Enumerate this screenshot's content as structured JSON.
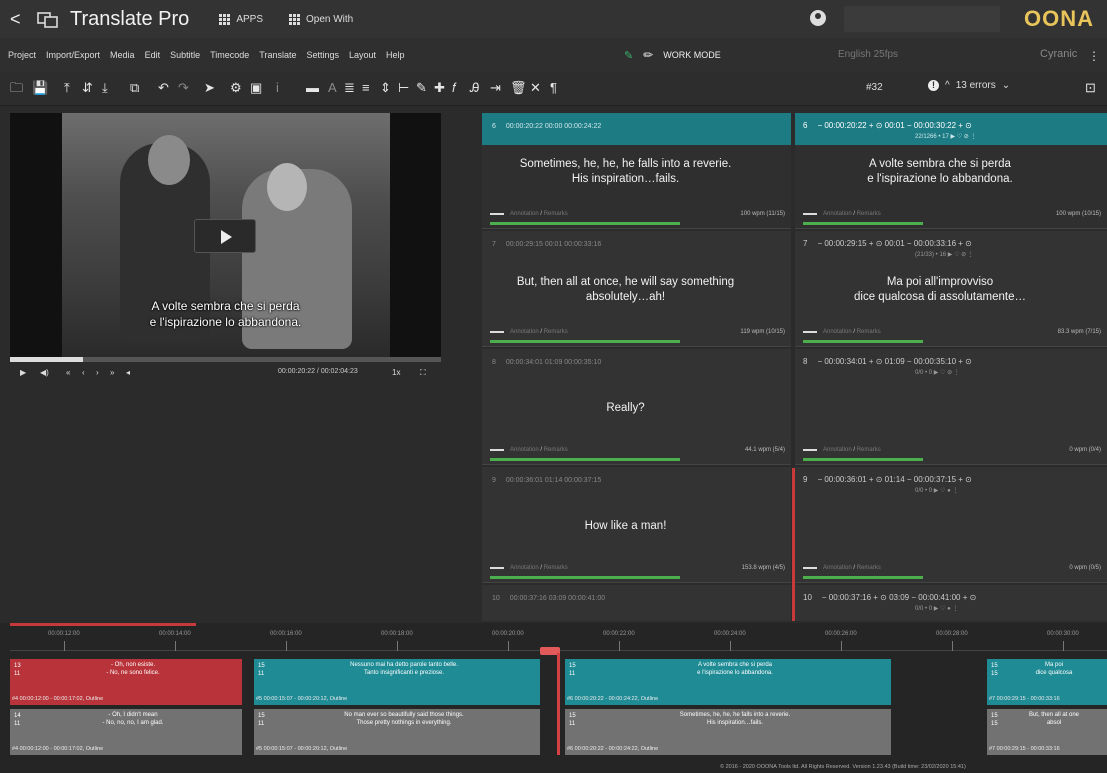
{
  "app": {
    "title": "Translate Pro",
    "apps_label": "APPS",
    "open_with_label": "Open With",
    "brand": "OONA"
  },
  "menu": [
    "Project",
    "Import/Export",
    "Media",
    "Edit",
    "Subtitle",
    "Timecode",
    "Translate",
    "Settings",
    "Layout",
    "Help"
  ],
  "workmode": {
    "label": "WORK MODE",
    "language": "English 25fps",
    "font": "Cyranic"
  },
  "toolbar": {
    "segment_number": "#32",
    "errors": "13 errors"
  },
  "video": {
    "subtitle_line1": "A volte sembra che si perda",
    "subtitle_line2": "e l'ispirazione lo abbandona.",
    "progress": 0.17,
    "timecode": "00:00:20:22 / 00:02:04:23",
    "speed": "1x"
  },
  "segments": [
    {
      "id": "6",
      "source_head": "00:00:20:22   00:00   00:00:24:22",
      "source_text": [
        "Sometimes, he, he, he falls into a reverie.",
        "His inspiration…fails."
      ],
      "source_rate": "100 wpm (11/15)",
      "target_head": "− 00:00:20:22 + ⊙   00:01   − 00:00:30:22 + ⊙",
      "target_sub": "22/1266 • 17   ▶ ♡ ⊘ ⋮",
      "target_text": [
        "A volte sembra che si perda",
        "e l'ispirazione lo abbandona."
      ],
      "target_rate": "100 wpm (10/15)",
      "active": true
    },
    {
      "id": "7",
      "source_head": "00:00:29:15   00:01   00:00:33:16",
      "source_text": [
        "But, then all at once, he will say something",
        "absolutely…ah!"
      ],
      "source_rate": "119 wpm (10/15)",
      "target_head": "− 00:00:29:15 + ⊙   00:01   − 00:00:33:16 + ⊙",
      "target_sub": "(21/33) • 16   ▶ ♡ ⊘ ⋮",
      "target_text": [
        "Ma poi all'improvviso",
        "dice qualcosa di assolutamente…"
      ],
      "target_rate": "83.3 wpm (7/15)",
      "active": false
    },
    {
      "id": "8",
      "source_head": "00:00:34:01   01:09   00:00:35:10",
      "source_text": [
        "Really?"
      ],
      "source_rate": "44.1 wpm (5/4)",
      "target_head": "− 00:00:34:01 + ⊙   01:09   − 00:00:35:10 + ⊙",
      "target_sub": "0/0 • 0   ▶ ♡ ⊘ ⋮",
      "target_text": [],
      "target_rate": "0 wpm (0/4)",
      "active": false
    },
    {
      "id": "9",
      "source_head": "00:00:36:01   01:14   00:00:37:15",
      "source_text": [
        "How like a man!"
      ],
      "source_rate": "153.8 wpm (4/5)",
      "target_head": "− 00:00:36:01 + ⊙   01:14   − 00:00:37:15 + ⊙",
      "target_sub": "0/0 • 0   ▶ ♡ ● ⋮",
      "target_text": [],
      "target_rate": "0 wpm (0/5)",
      "active": false
    },
    {
      "id": "10",
      "source_head": "00:00:37:16   03:09   00:00:41:00",
      "source_text": [],
      "source_rate": "",
      "target_head": "− 00:00:37:16 + ⊙   03:09   − 00:00:41:00 + ⊙",
      "target_sub": "0/0 • 0   ▶ ♡ ● ⋮",
      "target_text": [],
      "target_rate": "",
      "active": false
    }
  ],
  "annotation": {
    "label": "Annotation",
    "remarks": "Remarks"
  },
  "timeline": {
    "ticks": [
      "00:00:12:00",
      "00:00:14:00",
      "00:00:16:00",
      "00:00:18:00",
      "00:00:20:00",
      "00:00:22:00",
      "00:00:24:00",
      "00:00:26:00",
      "00:00:28:00",
      "00:00:30:00"
    ],
    "blocks_top": [
      {
        "nums": "13\n11",
        "text": "- Oh, non esiste.\n- No, ne sono felice.",
        "meta": "#4 00:00:12:00 - 00:00:17:02, Outline"
      },
      {
        "nums": "15\n11",
        "text": "Nessuno mai ha detto parole tanto belle.\nTanto insignificanti e preziose.",
        "meta": "#5 00:00:15:07 - 00:00:20:12, Outline"
      },
      {
        "nums": "15\n11",
        "text": "A volte sembra che si perda\ne l'ispirazione lo abbandona.",
        "meta": "#6 00:00:20:22 - 00:00:24:22, Outline"
      },
      {
        "nums": "15\n15",
        "text": "Ma poi\ndice qualcosa",
        "meta": "#7 00:00:29:15 - 00:00:33:16"
      }
    ],
    "blocks_bottom": [
      {
        "nums": "14\n11",
        "text": "- Oh, I didn't mean\n- No, no, no, I am glad.",
        "meta": "#4 00:00:12:00 - 00:00:17:02, Outline"
      },
      {
        "nums": "15\n11",
        "text": "No man ever so beautifully said those things.\nThose pretty nothings in everything.",
        "meta": "#5 00:00:15:07 - 00:00:20:12, Outline"
      },
      {
        "nums": "15\n11",
        "text": "Sometimes, he, he, he falls into a reverie.\nHis inspiration…fails.",
        "meta": "#6 00:00:20:22 - 00:00:24:22, Outline"
      },
      {
        "nums": "15\n15",
        "text": "But, then all at one\nabsol",
        "meta": "#7 00:00:29:15 - 00:00:33:16"
      }
    ],
    "footer": "© 2016 - 2020 OOONA Tools ltd. All Rights Reserved. Version 1.23.43 (Build time: 23/02/2020 15:41)"
  }
}
